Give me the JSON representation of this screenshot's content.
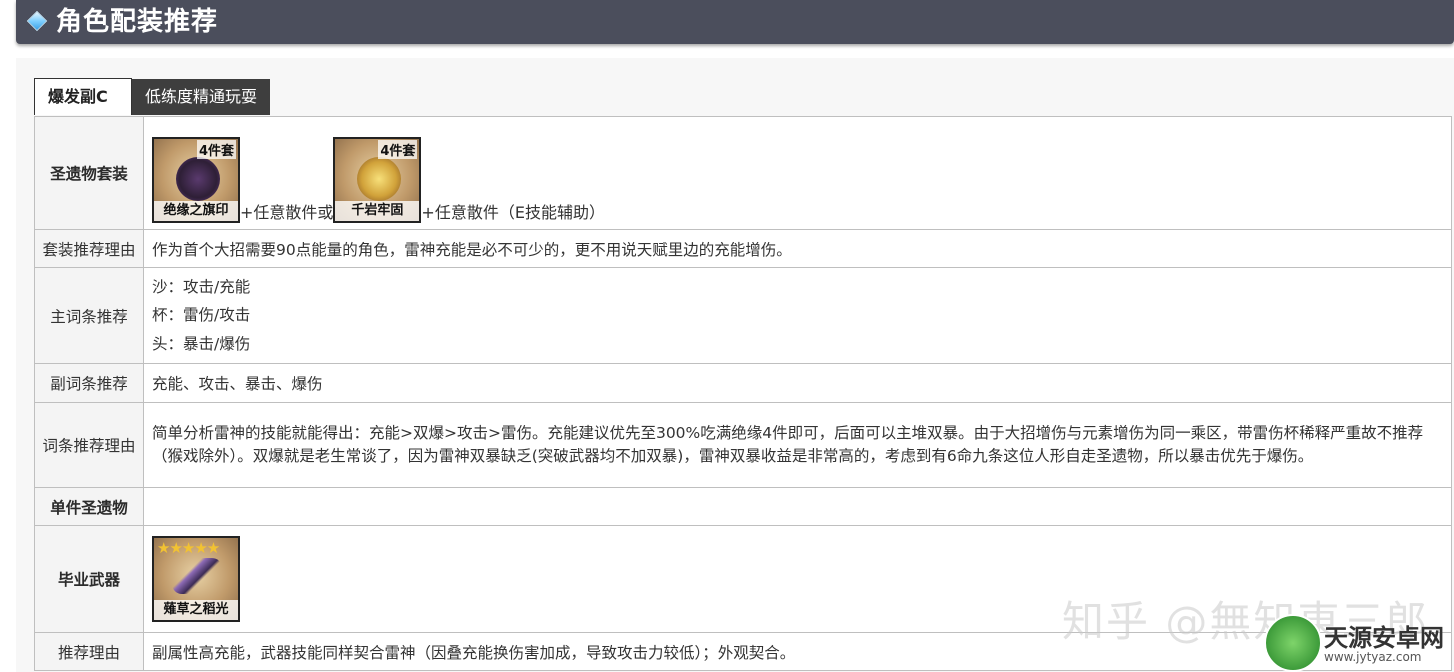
{
  "header": {
    "title": "角色配装推荐"
  },
  "tabs": [
    {
      "label": "爆发副C",
      "active": true
    },
    {
      "label": "低练度精通玩耍",
      "active": false
    }
  ],
  "rows": {
    "artifact_set": {
      "label": "圣遗物套装",
      "items": [
        {
          "badge": "4件套",
          "name": "绝缘之旗印",
          "suffix": "+任意散件或"
        },
        {
          "badge": "4件套",
          "name": "千岩牢固",
          "suffix": "+任意散件（E技能辅助）"
        }
      ]
    },
    "set_reason": {
      "label": "套装推荐理由",
      "text": "作为首个大招需要90点能量的角色，雷神充能是必不可少的，更不用说天赋里边的充能增伤。"
    },
    "main_stats": {
      "label": "主词条推荐",
      "lines": [
        "沙：攻击/充能",
        "杯：雷伤/攻击",
        "头：暴击/爆伤"
      ]
    },
    "sub_stats": {
      "label": "副词条推荐",
      "text": "充能、攻击、暴击、爆伤"
    },
    "stat_reason": {
      "label": "词条推荐理由",
      "text": "简单分析雷神的技能就能得出：充能>双爆>攻击>雷伤。充能建议优先至300%吃满绝缘4件即可，后面可以主堆双暴。由于大招增伤与元素增伤为同一乘区，带雷伤杯稀释严重故不推荐（猴戏除外）。双爆就是老生常谈了，因为雷神双暴缺乏(突破武器均不加双暴)，雷神双暴收益是非常高的，考虑到有6命九条这位人形自走圣遗物，所以暴击优先于爆伤。"
    },
    "single_artifact": {
      "label": "单件圣遗物",
      "text": ""
    },
    "weapon": {
      "label": "毕业武器",
      "stars": "★★★★★",
      "name": "薙草之稻光"
    },
    "weapon_reason": {
      "label": "推荐理由",
      "text": "副属性高充能，武器技能同样契合雷神（因叠充能换伤害加成，导致攻击力较低）；外观契合。"
    }
  },
  "watermark": {
    "text": "知乎 @無知東三郎",
    "site_name": "天源安卓网",
    "site_url": "www.jytyaz.com"
  }
}
